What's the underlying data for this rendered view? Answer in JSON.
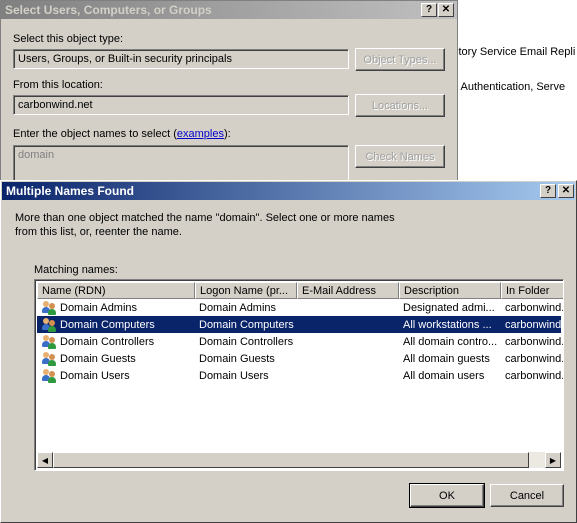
{
  "background_window": {
    "line1": "ctory Service Email Repli",
    "line2": "t Authentication, Serve"
  },
  "select_dialog": {
    "title": "Select Users, Computers, or Groups",
    "help_btn": "?",
    "close_btn": "✕",
    "object_type_label": "Select this object type:",
    "object_type_value": "Users, Groups, or Built-in security principals",
    "object_types_button": "Object Types...",
    "location_label": "From this location:",
    "location_value": "carbonwind.net",
    "locations_button": "Locations...",
    "enter_names_label_pre": "Enter the object names to select (",
    "examples_link": "examples",
    "enter_names_label_post": "):",
    "names_value": "domain",
    "check_names_button": "Check Names"
  },
  "multi_dialog": {
    "title": "Multiple Names Found",
    "help_btn": "?",
    "close_btn": "✕",
    "message_line1": "More than one object matched the name \"domain\". Select one or more names",
    "message_line2": "from this list, or, reenter the name.",
    "matching_label": "Matching names:",
    "columns": [
      "Name (RDN)",
      "Logon Name (pr...",
      "E-Mail Address",
      "Description",
      "In Folder"
    ],
    "rows": [
      {
        "name": "Domain Admins",
        "logon": "Domain Admins",
        "email": "",
        "desc": "Designated admi...",
        "folder": "carbonwind.n"
      },
      {
        "name": "Domain Computers",
        "logon": "Domain Computers",
        "email": "",
        "desc": "All workstations ...",
        "folder": "carbonwind.n"
      },
      {
        "name": "Domain Controllers",
        "logon": "Domain Controllers",
        "email": "",
        "desc": "All domain contro...",
        "folder": "carbonwind.n"
      },
      {
        "name": "Domain Guests",
        "logon": "Domain Guests",
        "email": "",
        "desc": "All domain guests",
        "folder": "carbonwind.n"
      },
      {
        "name": "Domain Users",
        "logon": "Domain Users",
        "email": "",
        "desc": "All domain users",
        "folder": "carbonwind.n"
      }
    ],
    "selected_row_index": 1,
    "ok_button": "OK",
    "cancel_button": "Cancel"
  },
  "colors": {
    "dialog_bg": "#d4d0c8",
    "inactive_title": "#a0a0a0",
    "active_title": "#0a246a",
    "selection": "#0a246a"
  }
}
